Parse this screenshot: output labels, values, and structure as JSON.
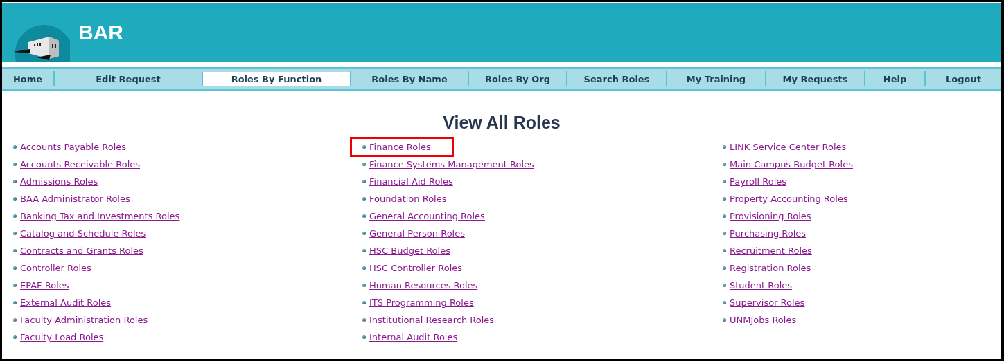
{
  "header": {
    "title": "BAR"
  },
  "nav": [
    {
      "label": "Home",
      "selected": false
    },
    {
      "label": "Edit Request",
      "selected": false
    },
    {
      "label": "Roles By Function",
      "selected": true
    },
    {
      "label": "Roles By Name",
      "selected": false
    },
    {
      "label": "Roles By Org",
      "selected": false
    },
    {
      "label": "Search Roles",
      "selected": false
    },
    {
      "label": "My Training",
      "selected": false
    },
    {
      "label": "My Requests",
      "selected": false
    },
    {
      "label": "Help",
      "selected": false
    },
    {
      "label": "Logout",
      "selected": false
    }
  ],
  "page_title": "View All Roles",
  "columns": [
    [
      {
        "label": "Accounts Payable Roles",
        "highlighted": false
      },
      {
        "label": "Accounts Receivable Roles",
        "highlighted": false
      },
      {
        "label": "Admissions Roles",
        "highlighted": false
      },
      {
        "label": "BAA Administrator Roles",
        "highlighted": false
      },
      {
        "label": "Banking Tax and Investments Roles",
        "highlighted": false
      },
      {
        "label": "Catalog and Schedule Roles",
        "highlighted": false
      },
      {
        "label": "Contracts and Grants Roles",
        "highlighted": false
      },
      {
        "label": "Controller Roles",
        "highlighted": false
      },
      {
        "label": "EPAF Roles",
        "highlighted": false
      },
      {
        "label": "External Audit Roles",
        "highlighted": false
      },
      {
        "label": "Faculty Administration Roles",
        "highlighted": false
      },
      {
        "label": "Faculty Load Roles",
        "highlighted": false
      }
    ],
    [
      {
        "label": "Finance Roles",
        "highlighted": true
      },
      {
        "label": "Finance Systems Management Roles",
        "highlighted": false
      },
      {
        "label": "Financial Aid Roles",
        "highlighted": false
      },
      {
        "label": "Foundation Roles",
        "highlighted": false
      },
      {
        "label": "General Accounting Roles",
        "highlighted": false
      },
      {
        "label": "General Person Roles",
        "highlighted": false
      },
      {
        "label": "HSC Budget Roles",
        "highlighted": false
      },
      {
        "label": "HSC Controller Roles",
        "highlighted": false
      },
      {
        "label": "Human Resources Roles",
        "highlighted": false
      },
      {
        "label": "ITS Programming Roles",
        "highlighted": false
      },
      {
        "label": "Institutional Research Roles",
        "highlighted": false
      },
      {
        "label": "Internal Audit Roles",
        "highlighted": false
      }
    ],
    [
      {
        "label": "LINK Service Center Roles",
        "highlighted": false
      },
      {
        "label": "Main Campus Budget Roles",
        "highlighted": false
      },
      {
        "label": "Payroll Roles",
        "highlighted": false
      },
      {
        "label": "Property Accounting Roles",
        "highlighted": false
      },
      {
        "label": "Provisioning Roles",
        "highlighted": false
      },
      {
        "label": "Purchasing Roles",
        "highlighted": false
      },
      {
        "label": "Recruitment Roles",
        "highlighted": false
      },
      {
        "label": "Registration Roles",
        "highlighted": false
      },
      {
        "label": "Student Roles",
        "highlighted": false
      },
      {
        "label": "Supervisor Roles",
        "highlighted": false
      },
      {
        "label": "UNMJobs Roles",
        "highlighted": false
      }
    ]
  ]
}
